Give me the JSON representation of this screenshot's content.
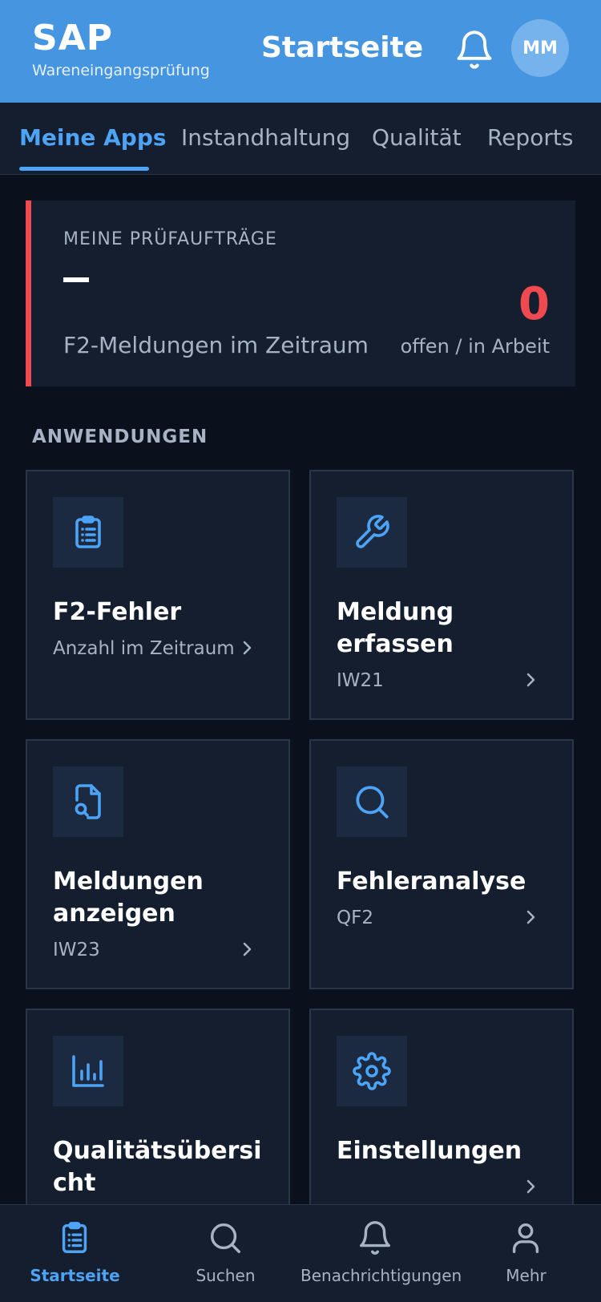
{
  "header": {
    "brand": "SAP",
    "subtitle": "Wareneingangsprüfung",
    "title": "Startseite",
    "avatar_initials": "MM",
    "bell_icon": "bell-icon"
  },
  "tabs": [
    {
      "label": "Meine Apps",
      "active": true
    },
    {
      "label": "Instandhaltung",
      "active": false
    },
    {
      "label": "Qualität",
      "active": false
    },
    {
      "label": "Reports",
      "active": false
    }
  ],
  "summary": {
    "label": "MEINE PRÜFAUFTRÄGE",
    "value_placeholder": "–",
    "description": "F2-Meldungen im Zeitraum",
    "count": "0",
    "status": "offen / in Arbeit",
    "accent_color": "#ef4a4f"
  },
  "section_heading": "ANWENDUNGEN",
  "tiles": [
    {
      "icon": "clipboard-list-icon",
      "title": "F2-Fehler",
      "subtitle": "Anzahl im Zeitraum"
    },
    {
      "icon": "wrench-icon",
      "title": "Meldung erfassen",
      "subtitle": "IW21"
    },
    {
      "icon": "file-search-icon",
      "title": "Meldungen anzeigen",
      "subtitle": "IW23"
    },
    {
      "icon": "search-icon",
      "title": "Fehleranalyse",
      "subtitle": "QF2"
    },
    {
      "icon": "bar-chart-icon",
      "title": "Qualitätsübersicht",
      "subtitle": ""
    },
    {
      "icon": "gear-icon",
      "title": "Einstellungen",
      "subtitle": ""
    }
  ],
  "bottom_nav": [
    {
      "label": "Startseite",
      "icon": "clipboard-list-icon",
      "active": true
    },
    {
      "label": "Suchen",
      "icon": "search-icon",
      "active": false
    },
    {
      "label": "Benachrichtigungen",
      "icon": "bell-icon",
      "active": false
    },
    {
      "label": "Mehr",
      "icon": "user-icon",
      "active": false
    }
  ],
  "colors": {
    "header": "#4595e0",
    "accent": "#4da3f5",
    "background": "#0b111c",
    "card": "#141e2e",
    "alert": "#ef4a4f"
  }
}
